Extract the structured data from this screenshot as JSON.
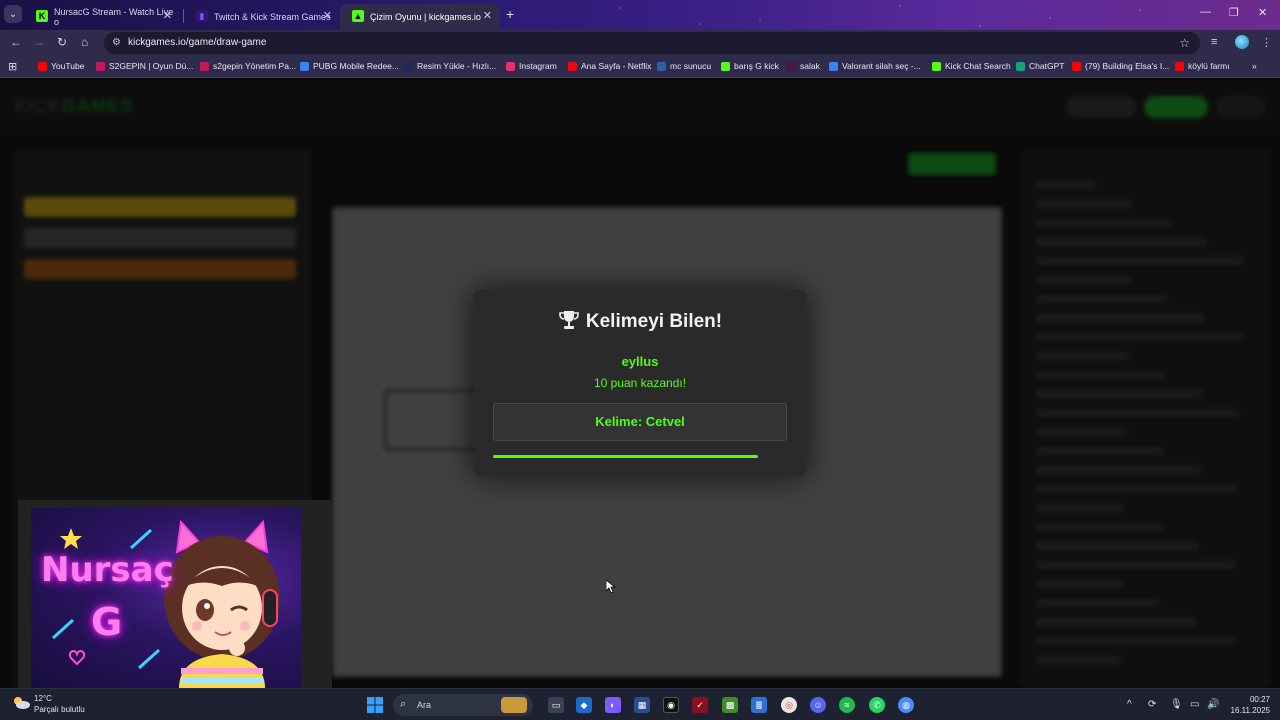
{
  "browser": {
    "tabs": [
      {
        "title": "NursacG Stream - Watch Live o",
        "favicon": "kick-icon",
        "active": false
      },
      {
        "title": "Twitch & Kick Stream Games",
        "favicon": "twitch-icon",
        "active": false
      },
      {
        "title": "Çizim Oyunu | kickgames.io",
        "favicon": "kickgames-icon",
        "active": true
      }
    ],
    "url": "kickgames.io/game/draw-game",
    "bookmarks": [
      {
        "label": "YouTube",
        "icon": "youtube-icon",
        "color": "#ff0000"
      },
      {
        "label": "S2GEPIN | Oyun Dü...",
        "icon": "s2gepin-icon",
        "color": "#c2185b"
      },
      {
        "label": "s2gepin Yönetim Pa...",
        "icon": "s2gepin-icon",
        "color": "#c2185b"
      },
      {
        "label": "PUBG Mobile Redee...",
        "icon": "pubg-icon",
        "color": "#3b82f6"
      },
      {
        "label": "Resim Yükle - Hızlı...",
        "icon": "upload-icon",
        "color": "#1f2a5c"
      },
      {
        "label": "Instagram",
        "icon": "instagram-icon",
        "color": "#e1306c"
      },
      {
        "label": "Ana Sayfa - Netflix",
        "icon": "netflix-icon",
        "color": "#e50914"
      },
      {
        "label": "mc sunucu",
        "icon": "minecraft-server-icon",
        "color": "#2b5fab"
      },
      {
        "label": "barış G kick",
        "icon": "kick-icon",
        "color": "#53fc18"
      },
      {
        "label": "salak",
        "icon": "slack-icon",
        "color": "#4a154b"
      },
      {
        "label": "Valorant silah seç -...",
        "icon": "valorant-icon",
        "color": "#3b82f6"
      },
      {
        "label": "Kick Chat Search",
        "icon": "kick-icon",
        "color": "#53fc18"
      },
      {
        "label": "ChatGPT",
        "icon": "chatgpt-icon",
        "color": "#10a37f"
      },
      {
        "label": "(79) Building Elsa's I...",
        "icon": "youtube-icon",
        "color": "#ff0000"
      },
      {
        "label": "köylü farmı",
        "icon": "youtube-icon",
        "color": "#ff0000"
      }
    ]
  },
  "modal": {
    "title": "Kelimeyi Bilen!",
    "winner": "eyllus",
    "points_text": "10 puan kazandı!",
    "word_text": "Kelime: Cetvel",
    "progress": 0.9
  },
  "webcam": {
    "name_line1": "Nursaç",
    "name_line2": "G"
  },
  "taskbar": {
    "weather_temp": "12°C",
    "weather_desc": "Parçalı bulutlu",
    "search_placeholder": "Ara",
    "time": "00:27",
    "date": "16.11.2025"
  },
  "colors": {
    "accent_green": "#53fc18",
    "modal_bg": "#2a2a2a"
  }
}
